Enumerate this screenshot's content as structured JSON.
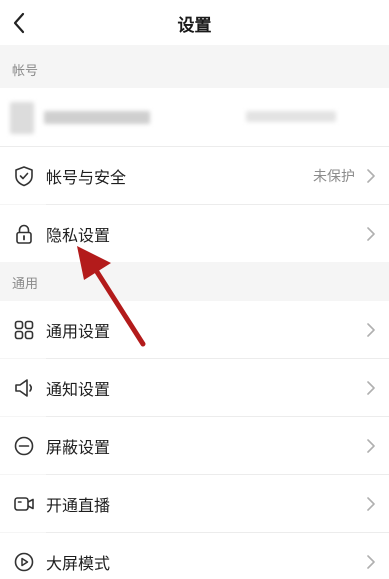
{
  "header": {
    "title": "设置"
  },
  "sections": {
    "account_label": "帐号",
    "general_label": "通用"
  },
  "rows": {
    "account_security": {
      "label": "帐号与安全",
      "value": "未保护"
    },
    "privacy": {
      "label": "隐私设置"
    },
    "general_settings": {
      "label": "通用设置"
    },
    "notifications": {
      "label": "通知设置"
    },
    "block": {
      "label": "屏蔽设置"
    },
    "live": {
      "label": "开通直播"
    },
    "big_screen": {
      "label": "大屏模式"
    }
  },
  "colors": {
    "annotation_arrow": "#b31b1b",
    "icon_stroke": "#333333",
    "chevron": "#b0b0b0"
  },
  "icons": {
    "back": "back-arrow-icon",
    "account_security": "shield-check-icon",
    "privacy": "lock-icon",
    "general_settings": "grid-icon",
    "notifications": "speaker-icon",
    "block": "minus-circle-icon",
    "live": "video-camera-icon",
    "big_screen": "play-circle-icon"
  }
}
